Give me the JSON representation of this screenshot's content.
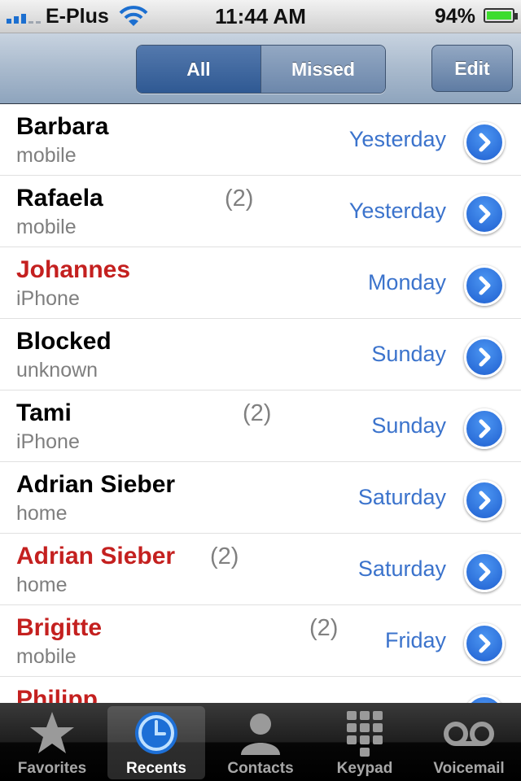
{
  "status_bar": {
    "carrier": "E-Plus",
    "time": "11:44 AM",
    "battery": "94%"
  },
  "nav": {
    "segments": [
      "All",
      "Missed"
    ],
    "selected": "All",
    "edit_label": "Edit"
  },
  "calls": [
    {
      "name": "Barbara",
      "count": "",
      "type": "mobile",
      "day": "Yesterday",
      "missed": false
    },
    {
      "name": "Rafaela",
      "count": "(2)",
      "type": "mobile",
      "day": "Yesterday",
      "missed": false
    },
    {
      "name": "Johannes",
      "count": "",
      "type": "iPhone",
      "day": "Monday",
      "missed": true
    },
    {
      "name": "Blocked",
      "count": "",
      "type": "unknown",
      "day": "Sunday",
      "missed": false
    },
    {
      "name": "Tami",
      "count": "(2)",
      "type": "iPhone",
      "day": "Sunday",
      "missed": false
    },
    {
      "name": "Adrian Sieber",
      "count": "",
      "type": "home",
      "day": "Saturday",
      "missed": false
    },
    {
      "name": "Adrian Sieber",
      "count": "(2)",
      "type": "home",
      "day": "Saturday",
      "missed": true
    },
    {
      "name": "Brigitte",
      "count": "(2)",
      "type": "mobile",
      "day": "Friday",
      "missed": true
    },
    {
      "name": "Philipp",
      "count": "",
      "type": "",
      "day": "",
      "missed": true
    }
  ],
  "tabs": [
    {
      "label": "Favorites",
      "icon": "star-icon"
    },
    {
      "label": "Recents",
      "icon": "clock-icon"
    },
    {
      "label": "Contacts",
      "icon": "person-icon"
    },
    {
      "label": "Keypad",
      "icon": "keypad-icon"
    },
    {
      "label": "Voicemail",
      "icon": "voicemail-icon"
    }
  ],
  "active_tab": "Recents",
  "colors": {
    "missed": "#c4201f",
    "day": "#3b73cc",
    "accent": "#1f5fd0"
  }
}
